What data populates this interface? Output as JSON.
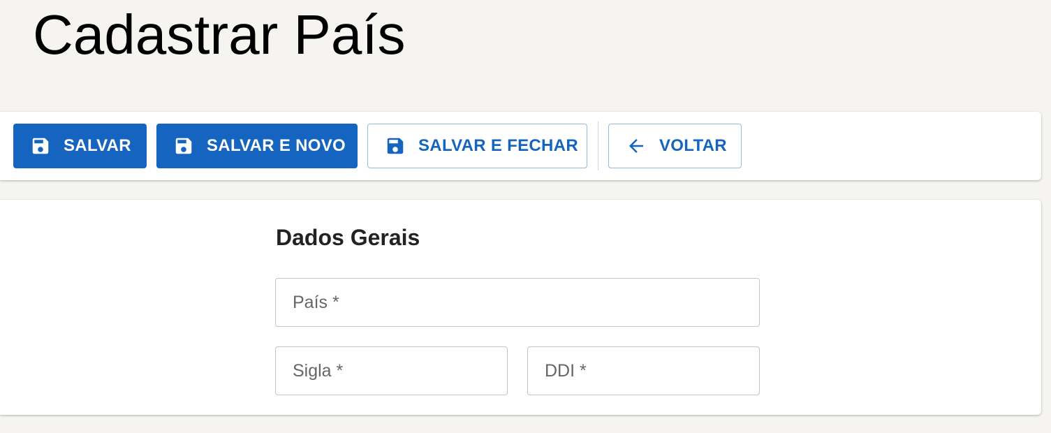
{
  "page": {
    "title": "Cadastrar País"
  },
  "toolbar": {
    "save_label": "SALVAR",
    "save_new_label": "SALVAR E NOVO",
    "save_close_label": "SALVAR E FECHAR",
    "back_label": "VOLTAR",
    "icons": [
      "save-icon",
      "save-icon",
      "save-icon",
      "arrow-left-icon"
    ]
  },
  "form": {
    "section_title": "Dados Gerais",
    "fields": {
      "pais": {
        "label": "País *",
        "value": ""
      },
      "sigla": {
        "label": "Sigla *",
        "value": ""
      },
      "ddi": {
        "label": "DDI *",
        "value": ""
      }
    }
  },
  "colors": {
    "primary": "#1565c0",
    "background": "#f5f4f1",
    "surface": "#ffffff"
  }
}
